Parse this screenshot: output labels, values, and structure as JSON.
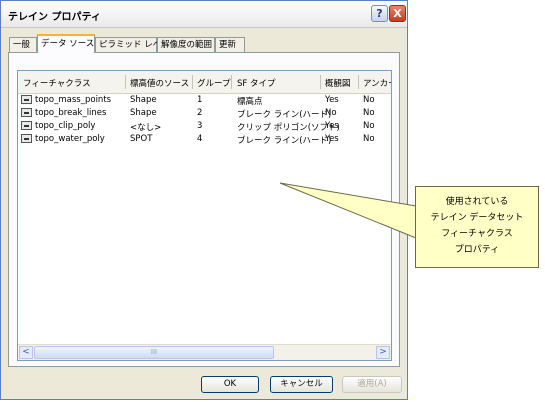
{
  "window": {
    "title": "テレイン プロパティ"
  },
  "titlebar": {
    "help_glyph": "?",
    "close_glyph": "X"
  },
  "tabs": [
    {
      "label": "一般"
    },
    {
      "label": "データ ソース"
    },
    {
      "label": "ピラミッド レベル"
    },
    {
      "label": "解像度の範囲"
    },
    {
      "label": "更新"
    }
  ],
  "table": {
    "headers": [
      "フィーチャクラス",
      "標高値のソース",
      "グループ",
      "SF タイプ",
      "概観図",
      "アンカー"
    ],
    "rows": [
      {
        "feature_class": "topo_mass_points",
        "source": "Shape",
        "group": "1",
        "sf_type": "標高点",
        "overview": "Yes",
        "anchor": "No"
      },
      {
        "feature_class": "topo_break_lines",
        "source": "Shape",
        "group": "2",
        "sf_type": "ブレーク ライン(ハード)",
        "overview": "No",
        "anchor": "No"
      },
      {
        "feature_class": "topo_clip_poly",
        "source": "<なし>",
        "group": "3",
        "sf_type": "クリップ ポリゴン(ソフト)",
        "overview": "Yes",
        "anchor": "No"
      },
      {
        "feature_class": "topo_water_poly",
        "source": "SPOT",
        "group": "4",
        "sf_type": "ブレーク ライン(ハード)",
        "overview": "Yes",
        "anchor": "No"
      }
    ]
  },
  "scrollbar": {
    "left_arrow": "<",
    "right_arrow": ">",
    "grip": "III"
  },
  "buttons": {
    "ok": "OK",
    "cancel": "キャンセル",
    "apply": "適用(A)"
  },
  "callout": {
    "lines": [
      "使用されている",
      "テレイン データセット",
      "フィーチャクラス",
      "プロパティ"
    ]
  }
}
